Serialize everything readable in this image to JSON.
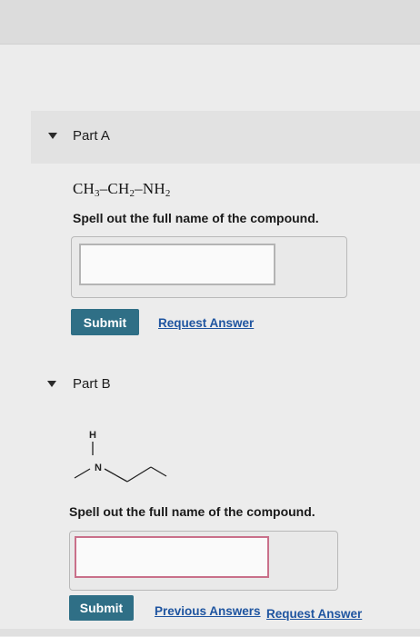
{
  "part_a": {
    "label": "Part A",
    "formula": {
      "t1": "CH",
      "s1": "3",
      "t2": "–CH",
      "s2": "2",
      "t3": "–NH",
      "s3": "2"
    },
    "question": "Spell out the full name of the compound.",
    "answer_value": "",
    "submit_label": "Submit",
    "request_answer_label": "Request Answer"
  },
  "part_b": {
    "label": "Part B",
    "structure_atoms": {
      "h": "H",
      "n": "N"
    },
    "question": "Spell out the full name of the compound.",
    "answer_value": "",
    "submit_label": "Submit",
    "previous_answers_label": "Previous Answers",
    "request_answer_label": "Request Answer"
  },
  "colors": {
    "submit_button": "#2f6f86",
    "link": "#1f55a0",
    "input_error_border": "#c9708a"
  }
}
